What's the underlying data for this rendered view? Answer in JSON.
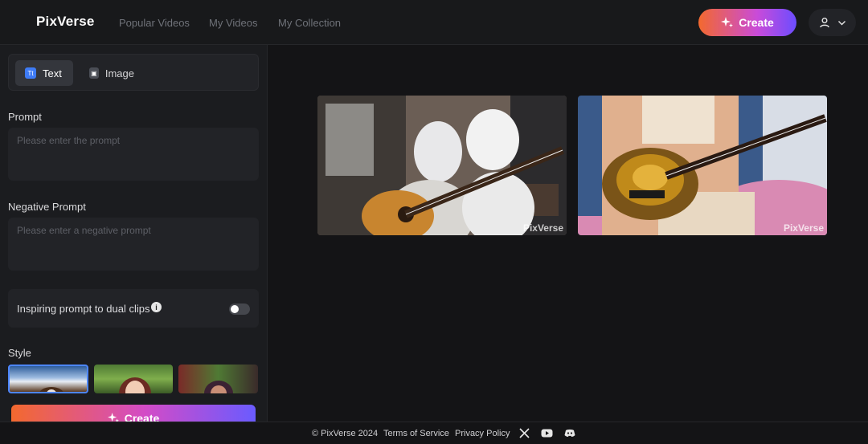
{
  "header": {
    "logo": "PixVerse",
    "nav": [
      "Popular Videos",
      "My Videos",
      "My Collection"
    ],
    "create_label": "Create"
  },
  "sidebar": {
    "tabs": [
      {
        "label": "Text",
        "icon": "text-icon",
        "active": true
      },
      {
        "label": "Image",
        "icon": "image-icon",
        "active": false
      }
    ],
    "prompt": {
      "label": "Prompt",
      "placeholder": "Please enter the prompt",
      "value": ""
    },
    "negative_prompt": {
      "label": "Negative Prompt",
      "placeholder": "Please enter a negative prompt",
      "value": ""
    },
    "dual_clips": {
      "label": "Inspiring prompt to dual clips",
      "enabled": false
    },
    "style": {
      "label": "Style"
    },
    "create_label": "Create"
  },
  "gallery": {
    "watermark": "PixVerse"
  },
  "footer": {
    "copyright": "© PixVerse 2024",
    "terms": "Terms of Service",
    "privacy": "Privacy Policy"
  },
  "colors": {
    "accent_start": "#f3692e",
    "accent_end": "#6c4dff",
    "background": "#141416",
    "panel": "#1b1c1f"
  }
}
